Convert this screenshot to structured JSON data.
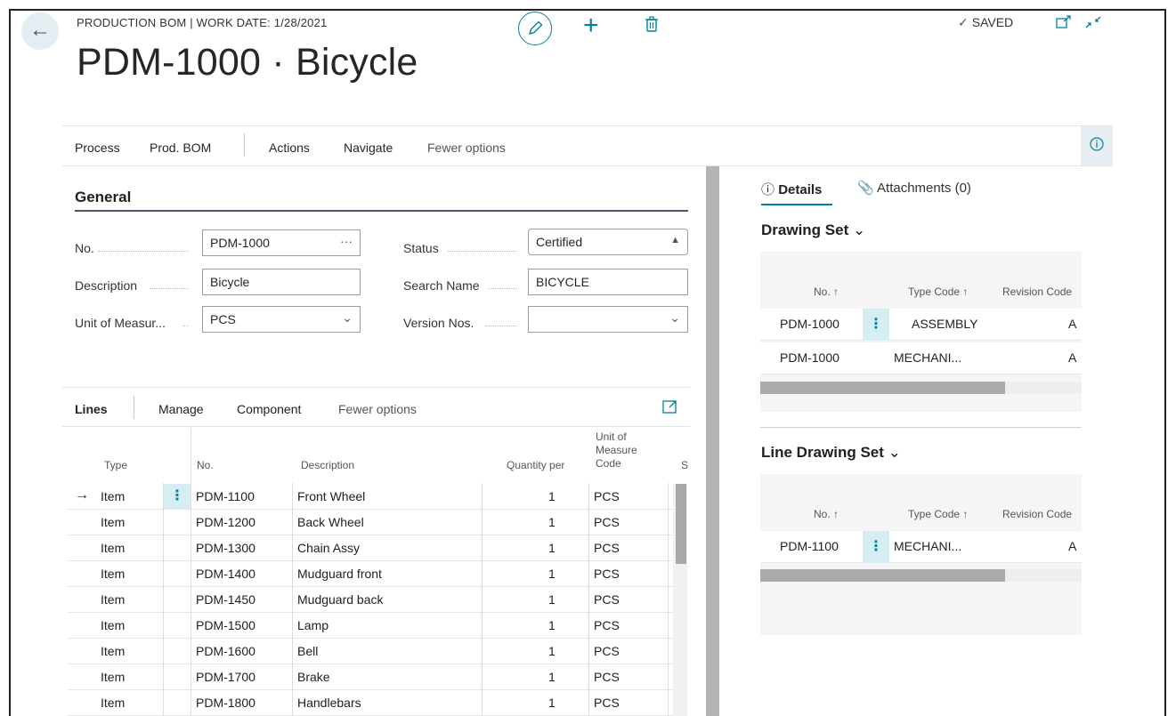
{
  "header": {
    "caption": "PRODUCTION BOM | WORK DATE: 1/28/2021",
    "title": "PDM-1000 · Bicycle",
    "saved": "SAVED",
    "back_icon": "arrow-left-icon",
    "accent_color": "#00829b"
  },
  "action_bar": {
    "items": [
      "Process",
      "Prod. BOM",
      "Actions",
      "Navigate",
      "Fewer options"
    ]
  },
  "general": {
    "title": "General",
    "no_label": "No.",
    "no_value": "PDM-1000",
    "description_label": "Description",
    "description_value": "Bicycle",
    "uom_label": "Unit of Measur...",
    "uom_value": "PCS",
    "status_label": "Status",
    "status_value": "Certified",
    "search_name_label": "Search Name",
    "search_name_value": "BICYCLE",
    "version_nos_label": "Version Nos.",
    "version_nos_value": ""
  },
  "lines": {
    "title": "Lines",
    "actions": [
      "Manage",
      "Component",
      "Fewer options"
    ],
    "columns": {
      "type": "Type",
      "no": "No.",
      "description": "Description",
      "quantity_per": "Quantity per",
      "uom_line1": "Unit of",
      "uom_line2": "Measure",
      "uom_line3": "Code",
      "s": "S"
    },
    "rows": [
      {
        "type": "Item",
        "no": "PDM-1100",
        "description": "Front Wheel",
        "qty": "1",
        "uom": "PCS"
      },
      {
        "type": "Item",
        "no": "PDM-1200",
        "description": "Back Wheel",
        "qty": "1",
        "uom": "PCS"
      },
      {
        "type": "Item",
        "no": "PDM-1300",
        "description": "Chain Assy",
        "qty": "1",
        "uom": "PCS"
      },
      {
        "type": "Item",
        "no": "PDM-1400",
        "description": "Mudguard front",
        "qty": "1",
        "uom": "PCS"
      },
      {
        "type": "Item",
        "no": "PDM-1450",
        "description": "Mudguard back",
        "qty": "1",
        "uom": "PCS"
      },
      {
        "type": "Item",
        "no": "PDM-1500",
        "description": "Lamp",
        "qty": "1",
        "uom": "PCS"
      },
      {
        "type": "Item",
        "no": "PDM-1600",
        "description": "Bell",
        "qty": "1",
        "uom": "PCS"
      },
      {
        "type": "Item",
        "no": "PDM-1700",
        "description": "Brake",
        "qty": "1",
        "uom": "PCS"
      },
      {
        "type": "Item",
        "no": "PDM-1800",
        "description": "Handlebars",
        "qty": "1",
        "uom": "PCS"
      }
    ]
  },
  "factbox": {
    "tab_details": "Details",
    "tab_attachments": "Attachments (0)",
    "drawing_set": {
      "title": "Drawing Set",
      "columns": {
        "no": "No. ↑",
        "type_code": "Type Code ↑",
        "revision_code": "Revision Code"
      },
      "rows": [
        {
          "no": "PDM-1000",
          "type_code": "ASSEMBLY",
          "revision_code": "A"
        },
        {
          "no": "PDM-1000",
          "type_code": "MECHANI...",
          "revision_code": "A"
        }
      ]
    },
    "line_drawing_set": {
      "title": "Line Drawing Set",
      "columns": {
        "no": "No. ↑",
        "type_code": "Type Code ↑",
        "revision_code": "Revision Code"
      },
      "rows": [
        {
          "no": "PDM-1100",
          "type_code": "MECHANI...",
          "revision_code": "A"
        }
      ]
    }
  }
}
